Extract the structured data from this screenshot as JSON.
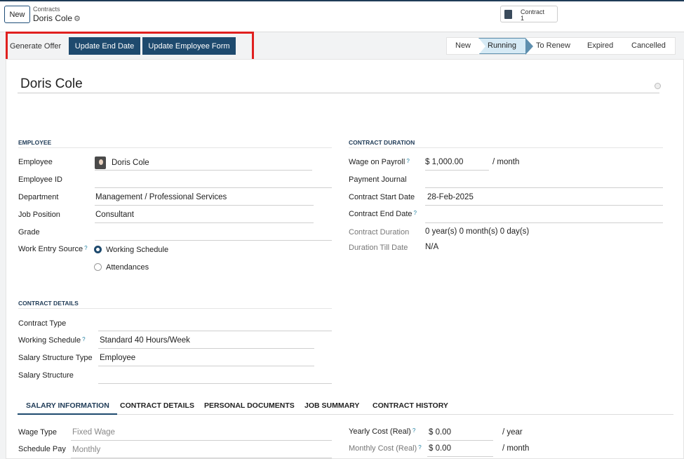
{
  "header": {
    "new_label": "New",
    "breadcrumb": "Contracts",
    "record_title": "Doris Cole",
    "smart_button": {
      "label": "Contract",
      "count": "1"
    }
  },
  "actions": {
    "generate_offer": "Generate Offer",
    "update_end_date": "Update End Date",
    "update_employee_form": "Update Employee Form"
  },
  "stages": {
    "new": "New",
    "running": "Running",
    "to_renew": "To Renew",
    "expired": "Expired",
    "cancelled": "Cancelled",
    "current": "Running"
  },
  "form": {
    "name": "Doris Cole",
    "employee_section": {
      "title": "EMPLOYEE",
      "employee_label": "Employee",
      "employee_value": "Doris Cole",
      "employee_id_label": "Employee ID",
      "department_label": "Department",
      "department_value": "Management / Professional Services",
      "job_position_label": "Job Position",
      "job_position_value": "Consultant",
      "grade_label": "Grade",
      "work_entry_label": "Work Entry Source",
      "work_entry_options": [
        "Working Schedule",
        "Attendances"
      ],
      "work_entry_selected": "Working Schedule"
    },
    "duration_section": {
      "title": "CONTRACT DURATION",
      "wage_label": "Wage on Payroll",
      "wage_value": "$ 1,000.00",
      "wage_unit": "/ month",
      "journal_label": "Payment Journal",
      "start_label": "Contract Start Date",
      "start_value": "28-Feb-2025",
      "end_label": "Contract End Date",
      "duration_label": "Contract Duration",
      "duration_value": "0 year(s) 0 month(s) 0 day(s)",
      "till_label": "Duration Till Date",
      "till_value": "N/A"
    },
    "details_section": {
      "title": "CONTRACT DETAILS",
      "type_label": "Contract Type",
      "schedule_label": "Working Schedule",
      "schedule_value": "Standard 40 Hours/Week",
      "struct_type_label": "Salary Structure Type",
      "struct_type_value": "Employee",
      "struct_label": "Salary Structure"
    },
    "tabs": [
      "SALARY INFORMATION",
      "CONTRACT DETAILS",
      "PERSONAL DOCUMENTS",
      "JOB SUMMARY",
      "CONTRACT HISTORY"
    ],
    "salary": {
      "wage_type_label": "Wage Type",
      "wage_type_value": "Fixed Wage",
      "schedule_pay_label": "Schedule Pay",
      "schedule_pay_value": "Monthly",
      "yearly_label": "Yearly Cost (Real)",
      "yearly_value": "$ 0.00",
      "yearly_unit": "/ year",
      "monthly_label": "Monthly Cost (Real)",
      "monthly_value": "$ 0.00",
      "monthly_unit": "/ month"
    }
  },
  "colors": {
    "primary": "#1e4a6e",
    "highlight": "#e0201f",
    "running_bg": "#d6eaf5"
  }
}
